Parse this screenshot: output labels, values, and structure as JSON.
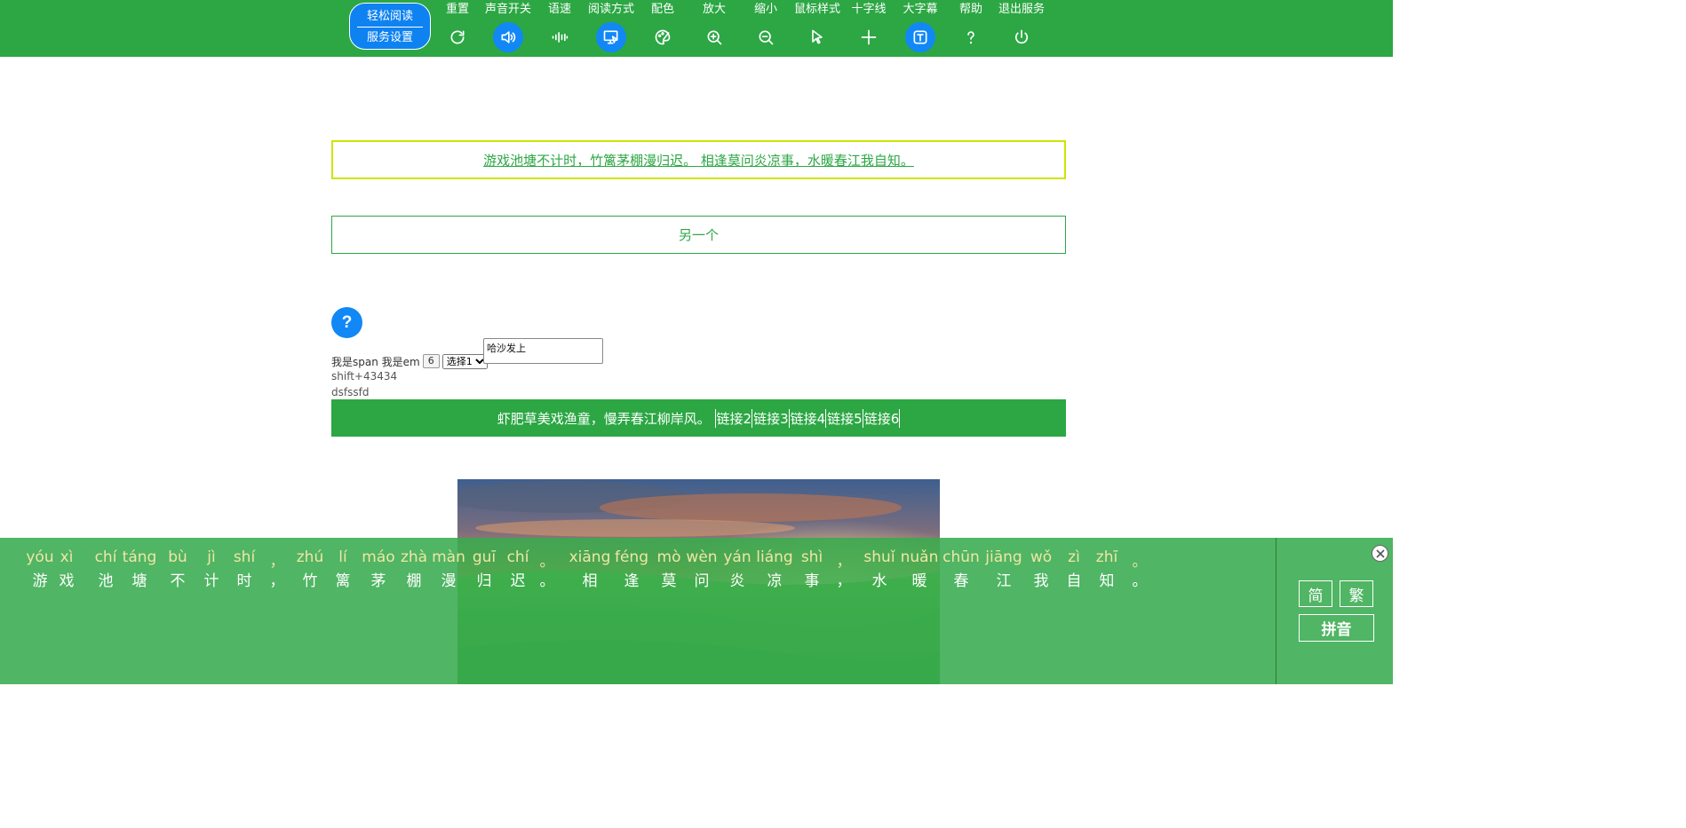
{
  "toolbar": {
    "brand_top": "轻松阅读",
    "brand_bottom": "服务设置",
    "tools": [
      {
        "label": "重置",
        "icon": "reset-icon",
        "active": false
      },
      {
        "label": "声音开关",
        "icon": "speaker-icon",
        "active": true
      },
      {
        "label": "语速",
        "icon": "speed-wave-icon",
        "active": false
      },
      {
        "label": "阅读方式",
        "icon": "reading-mode-icon",
        "active": true
      },
      {
        "label": "配色",
        "icon": "palette-icon",
        "active": false
      },
      {
        "label": "放大",
        "icon": "zoom-in-icon",
        "active": false
      },
      {
        "label": "缩小",
        "icon": "zoom-out-icon",
        "active": false
      },
      {
        "label": "鼠标样式",
        "icon": "cursor-icon",
        "active": false
      },
      {
        "label": "十字线",
        "icon": "crosshair-icon",
        "active": false
      },
      {
        "label": "大字幕",
        "icon": "subtitle-icon",
        "active": true
      },
      {
        "label": "帮助",
        "icon": "help-icon",
        "active": false
      },
      {
        "label": "退出服务",
        "icon": "power-icon",
        "active": false
      }
    ],
    "bg_color": "#2ca744",
    "active_color": "#1188f5"
  },
  "content": {
    "poem_link": "游戏池塘不计时，竹篱茅棚漫归迟。 相逢莫问炎凉事，水暖春江我自知。",
    "another": "另一个",
    "help_glyph": "?",
    "span_text": "我是span",
    "em_text": "我是em",
    "number_value": "6",
    "select_value": "选择1",
    "textarea_value": "哈沙发上",
    "line3": "shift+43434",
    "line4": "dsfssfd",
    "bar_text": "虾肥草美戏渔童，慢弄春江柳岸风。",
    "bar_links": [
      "链接2",
      "链接3",
      "链接4",
      "链接5",
      "链接6"
    ]
  },
  "subtitle": {
    "pinyin": [
      "yóu",
      "xì",
      "chí",
      "táng",
      "bù",
      "jì",
      "shí",
      "，",
      "zhú",
      "lí",
      "máo",
      "zhà",
      "màn",
      "guī",
      "chí",
      "。",
      "xiāng",
      "féng",
      "mò",
      "wèn",
      "yán",
      "liáng",
      "shì",
      "，",
      "shuǐ",
      "nuǎn",
      "chūn",
      "jiāng",
      "wǒ",
      "zì",
      "zhī",
      "。"
    ],
    "hanzi": [
      "游",
      "戏",
      "池",
      "塘",
      "不",
      "计",
      "时",
      "，",
      "竹",
      "篱",
      "茅",
      "棚",
      "漫",
      "归",
      "迟",
      "。",
      "相",
      "逢",
      "莫",
      "问",
      "炎",
      "凉",
      "事",
      "，",
      "水",
      "暖",
      "春",
      "江",
      "我",
      "自",
      "知",
      "。"
    ],
    "simplified_label": "简",
    "traditional_label": "繁",
    "pinyin_label": "拼音",
    "pinyin_color": "#f0e6a4"
  }
}
